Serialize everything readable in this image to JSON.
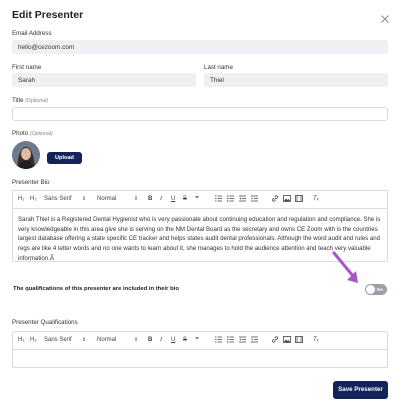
{
  "dialog": {
    "title": "Edit Presenter",
    "close_icon": "close-icon"
  },
  "email": {
    "label": "Email Address",
    "value": "hello@cezoom.com"
  },
  "first_name": {
    "label": "First name",
    "value": "Sarah"
  },
  "last_name": {
    "label": "Last name",
    "value": "Thiel"
  },
  "title_field": {
    "label": "Title",
    "optional": "(Optional)",
    "value": ""
  },
  "photo": {
    "label": "Photo",
    "optional": "(Optional)",
    "upload_label": "Upload"
  },
  "bio": {
    "label": "Presenter Bio",
    "toolbar": {
      "h1": "H₁",
      "h2": "H₂",
      "font": "Sans Serif",
      "size": "Normal"
    },
    "text": "Sarah Thiel is a Registered Dental Hygienist who is very passionate about continuing education and regulation and compliance. She is very knowledgeable in this area give she is serving on the NM Dental Board as the secretary and owns CE Zoom with is the countries largest database offering a state specific CE tracker and helps states audit dental professionals. Although the word audit and rules and regs are like 4 letter words and no one wants to learn about it, she manages to hold the audience attention and teach very valuable information.Â"
  },
  "qualifications_toggle": {
    "label": "The qualifications of this presenter are included in their bio",
    "state": "No",
    "on": false
  },
  "qualifications": {
    "label": "Presenter Qualifications",
    "toolbar": {
      "h1": "H₁",
      "h2": "H₂",
      "font": "Sans Serif",
      "size": "Normal"
    },
    "text": ""
  },
  "save_label": "Save Presenter",
  "colors": {
    "primary": "#14245a",
    "annotation_arrow": "#a855c9",
    "field_bg": "#eef0f3"
  }
}
